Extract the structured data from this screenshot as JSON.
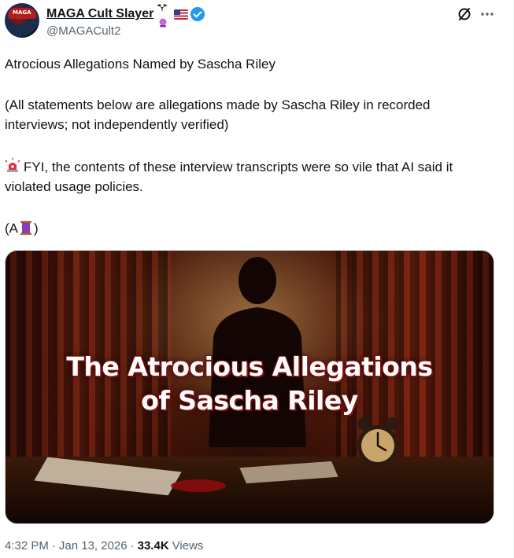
{
  "author": {
    "display_name": "MAGA Cult Slayer",
    "handle": "@MAGACult2",
    "avatar_text": "MAGA",
    "badges": [
      "eagle-emoji",
      "crystal-ball-emoji",
      "us-flag-emoji",
      "verified-badge"
    ]
  },
  "post": {
    "paragraphs": [
      "Atrocious Allegations Named by Sascha Riley",
      "(All statements below are allegations made by Sascha Riley in recorded interviews; not independently verified)",
      "FYI, the contents of these interview transcripts were so vile that AI said it violated usage policies.",
      "(A",
      ")"
    ],
    "emojis": [
      "siren-emoji",
      "thread-spool-emoji"
    ]
  },
  "media": {
    "title_line1": "The Atrocious Allegations",
    "title_line2": "of Sascha Riley"
  },
  "footer": {
    "time": "4:32 PM",
    "separator": "·",
    "date": "Jan 13, 2026",
    "views_count": "33.4K",
    "views_label": "Views"
  },
  "colors": {
    "text_primary": "#0f1419",
    "text_secondary": "#536471",
    "verified_blue": "#1d9bf0",
    "border": "#cfd9de"
  }
}
